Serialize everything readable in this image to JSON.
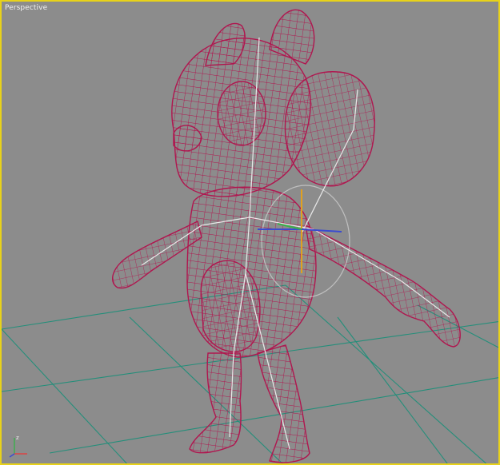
{
  "viewport": {
    "label": "Perspective",
    "active_border_color": "#e8d21a",
    "background_color": "#8c8c8c"
  },
  "scene": {
    "grid_color": "#1f8f7a",
    "mesh_color": "#b0164f",
    "bone_color": "#f4f4f4",
    "character": "cartoon-chipmunk-wireframe"
  },
  "axis_gizmo": {
    "x_color": "#3a4bd0",
    "y_color": "#3ab04a",
    "z_color": "#e0a020"
  }
}
